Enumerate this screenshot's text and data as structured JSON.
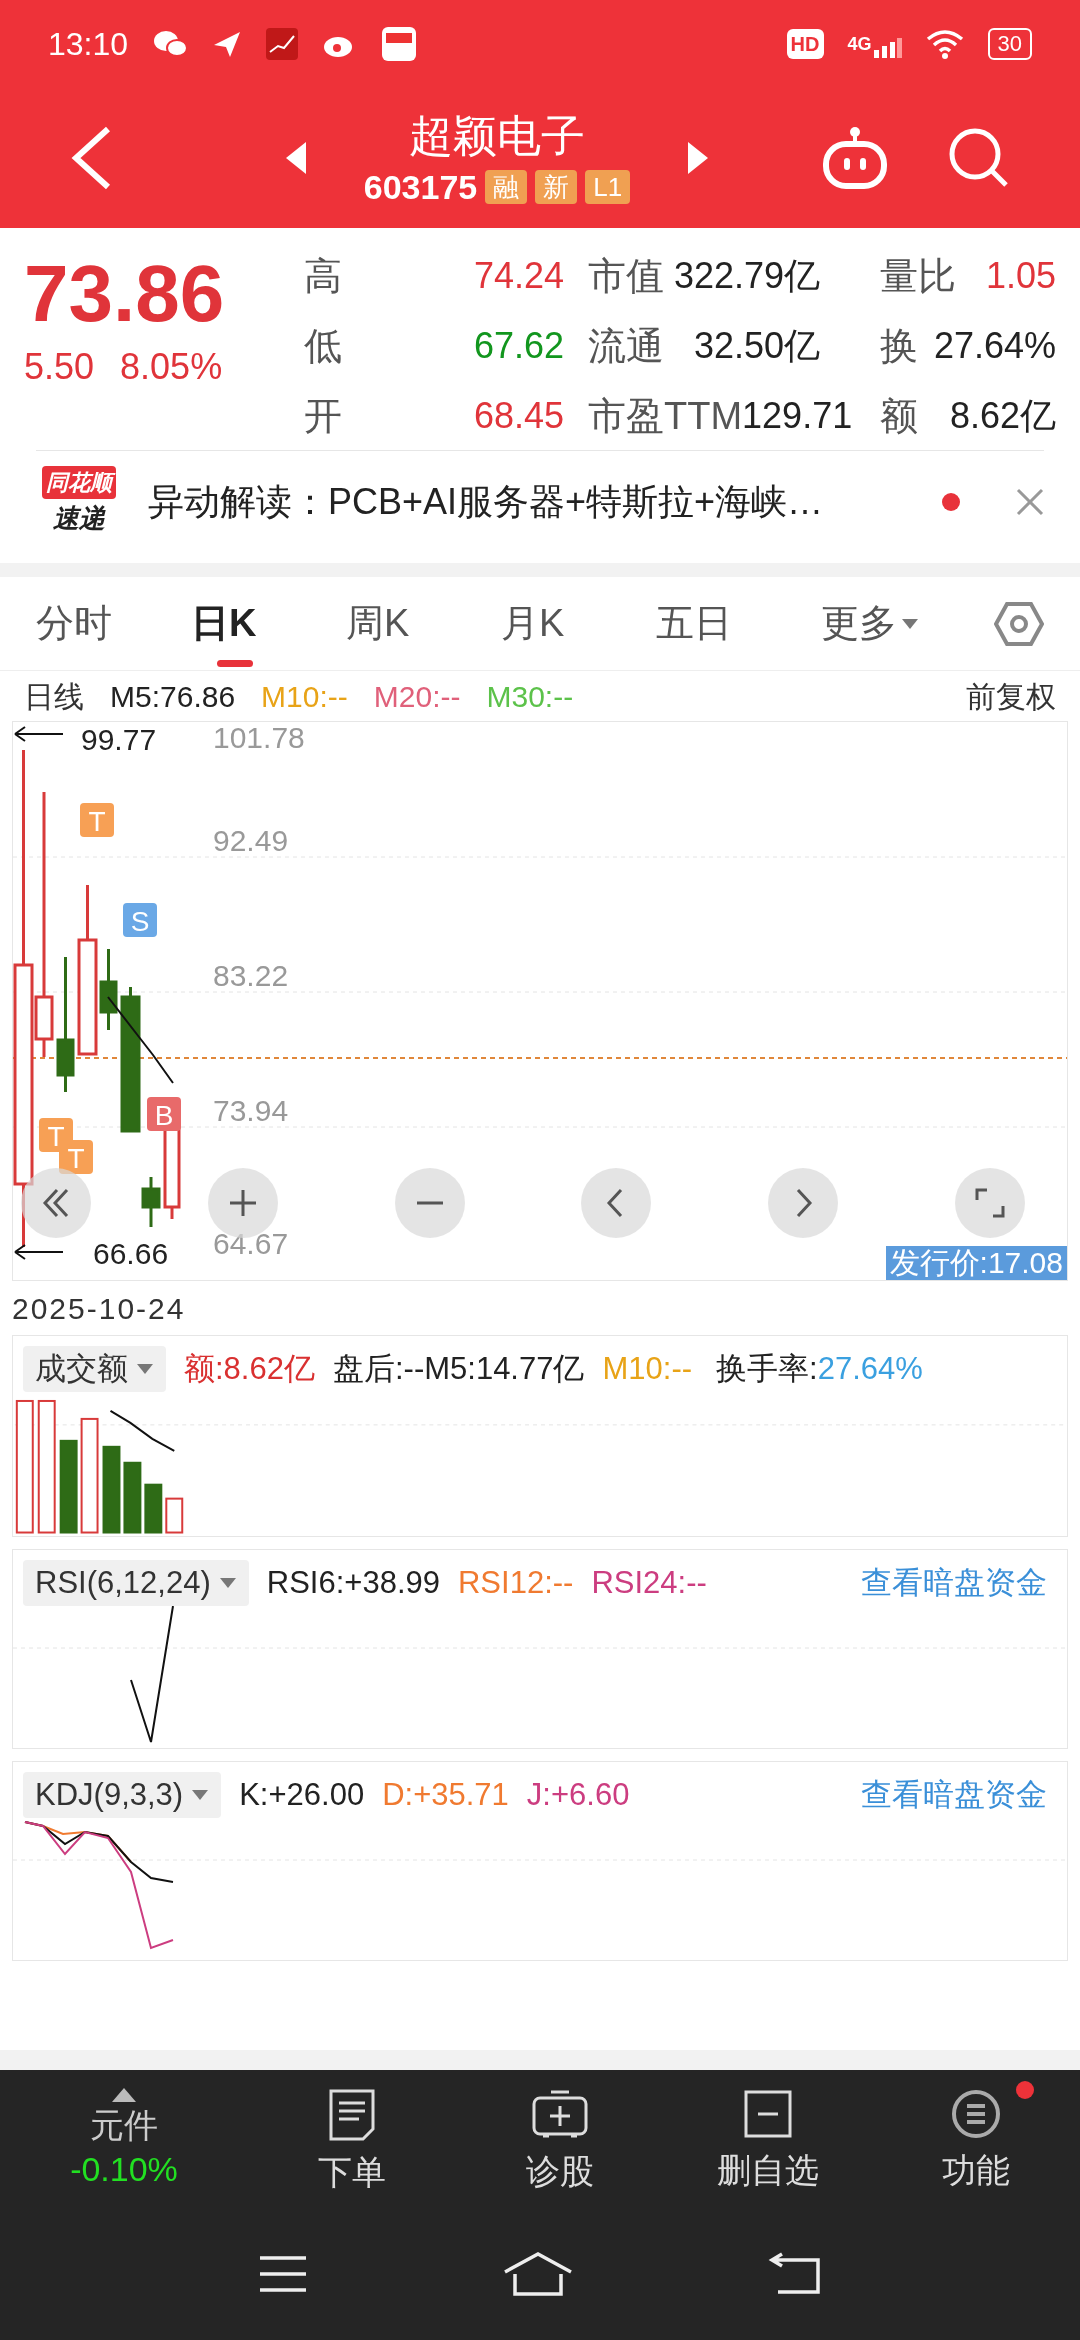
{
  "status_bar": {
    "time": "13:10",
    "hd": "HD",
    "network": "4G",
    "battery": "30"
  },
  "header": {
    "title": "超颖电子",
    "code": "603175",
    "badges": [
      "融",
      "新",
      "L1"
    ]
  },
  "quote": {
    "price": "73.86",
    "change": "5.50",
    "change_pct": "8.05%",
    "stats": [
      {
        "label": "高",
        "value": "74.24",
        "kind": "up"
      },
      {
        "label": "市值",
        "value": "322.79亿",
        "kind": "neutral"
      },
      {
        "label": "量比",
        "value": "1.05",
        "kind": "up"
      },
      {
        "label": "低",
        "value": "67.62",
        "kind": "down"
      },
      {
        "label": "流通",
        "value": "32.50亿",
        "kind": "neutral"
      },
      {
        "label": "换",
        "value": "27.64%",
        "kind": "neutral"
      },
      {
        "label": "开",
        "value": "68.45",
        "kind": "up"
      },
      {
        "label": "市盈TTM",
        "value": "129.71",
        "kind": "neutral"
      },
      {
        "label": "额",
        "value": "8.62亿",
        "kind": "neutral"
      }
    ]
  },
  "news": {
    "logo_top": "同花顺",
    "logo_bottom": "速递",
    "text": "异动解读：PCB+AI服务器+特斯拉+海峡…",
    "unread": true
  },
  "tabs": [
    {
      "label": "分时",
      "selected": false
    },
    {
      "label": "日K",
      "selected": true
    },
    {
      "label": "周K",
      "selected": false
    },
    {
      "label": "月K",
      "selected": false
    },
    {
      "label": "五日",
      "selected": false
    },
    {
      "label": "更多",
      "selected": false
    }
  ],
  "ma_legend": {
    "period": "日线",
    "items": [
      {
        "text": "M5:76.86",
        "color": "#222222"
      },
      {
        "text": "M10:--",
        "color": "#e8a317"
      },
      {
        "text": "M20:--",
        "color": "#e0607a"
      },
      {
        "text": "M30:--",
        "color": "#5cc24a"
      }
    ],
    "adjust": "前复权"
  },
  "kline": {
    "y_labels": [
      "101.78",
      "92.49",
      "83.22",
      "73.94",
      "64.67"
    ],
    "high_marker": "99.77",
    "low_marker": "66.66",
    "signals": [
      {
        "label": "T",
        "kind": "t"
      },
      {
        "label": "S",
        "kind": "s"
      },
      {
        "label": "B",
        "kind": "b"
      },
      {
        "label": "T",
        "kind": "t"
      },
      {
        "label": "T",
        "kind": "t"
      }
    ],
    "issue_price": "发行价:17.08",
    "date": "2025-10-24"
  },
  "volume": {
    "selector": "成交额",
    "readings": [
      {
        "text": "额:8.62亿",
        "color": "#d93030"
      },
      {
        "text": "盘后:--M5:14.77亿",
        "color": "#222222"
      },
      {
        "text": "M10:--",
        "color": "#e8a317"
      }
    ],
    "turnover_label": "换手率:",
    "turnover": "27.64%"
  },
  "rsi": {
    "selector": "RSI(6,12,24)",
    "readings": [
      {
        "text": "RSI6:+38.99",
        "color": "#222222"
      },
      {
        "text": "RSI12:--",
        "color": "#f07a30"
      },
      {
        "text": "RSI24:--",
        "color": "#cc3d80"
      }
    ],
    "link": "查看暗盘资金"
  },
  "kdj": {
    "selector": "KDJ(9,3,3)",
    "readings": [
      {
        "text": "K:+26.00",
        "color": "#222222"
      },
      {
        "text": "D:+35.71",
        "color": "#f07a30"
      },
      {
        "text": "J:+6.60",
        "color": "#cc3d80"
      }
    ],
    "link": "查看暗盘资金"
  },
  "bottom_nav": {
    "stock_name": "元件",
    "stock_change": "-0.10%",
    "items": [
      {
        "label": "下单",
        "kind": "order",
        "badge": false
      },
      {
        "label": "诊股",
        "kind": "diagnose",
        "badge": false
      },
      {
        "label": "删自选",
        "kind": "remove",
        "badge": false
      },
      {
        "label": "功能",
        "kind": "menu",
        "badge": true
      }
    ]
  }
}
